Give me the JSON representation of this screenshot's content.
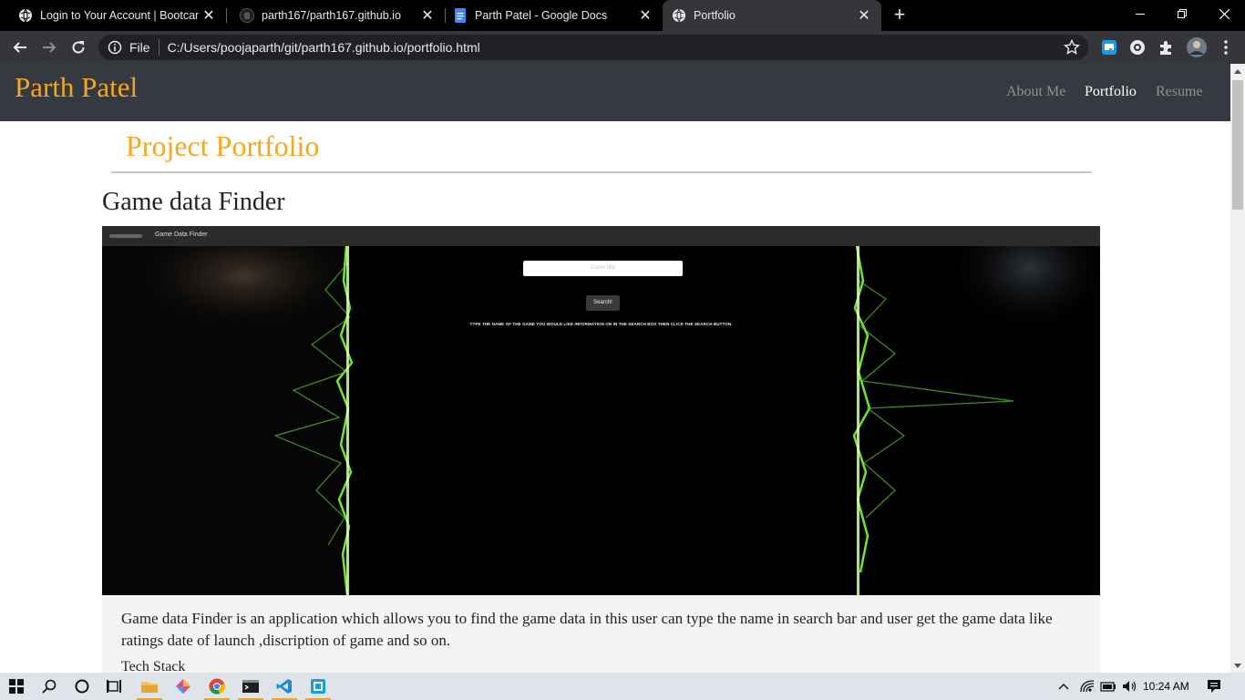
{
  "browser": {
    "tabs": [
      {
        "title": "Login to Your Account | Bootcam",
        "favicon": "globe-icon",
        "active": false
      },
      {
        "title": "parth167/parth167.github.io",
        "favicon": "github-icon",
        "active": false
      },
      {
        "title": "Parth Patel - Google Docs",
        "favicon": "google-docs-icon",
        "active": false
      },
      {
        "title": "Portfolio",
        "favicon": "globe-icon",
        "active": true
      }
    ],
    "address": {
      "scheme_label": "File",
      "url": "C:/Users/poojaparth/git/parth167.github.io/portfolio.html"
    }
  },
  "site": {
    "brand": "Parth Patel",
    "nav": [
      {
        "label": "About Me",
        "active": false
      },
      {
        "label": "Portfolio",
        "active": true
      },
      {
        "label": "Resume",
        "active": false
      }
    ],
    "section_title": "Project Portfolio",
    "project": {
      "title": "Game data Finder",
      "screenshot": {
        "app_brand": "Game Data Finder",
        "input_placeholder": "Game title",
        "button_label": "Search!",
        "help_text": "TYPE THE NAME OF THE GAME YOU WOULD LIKE INFORMATION ON IN THE SEARCH BOX THEN CLICK THE SEARCH BUTTON."
      },
      "description": "Game data Finder is an application which allows you to find the game data in this user can type the name in search bar and user get the game data like ratings date of launch ,discription of game and so on.",
      "next_heading_partial": "Tech Stack"
    },
    "colors": {
      "brand": "#f5a623",
      "navbar": "#343a40"
    }
  },
  "taskbar": {
    "time": "10:24 AM"
  }
}
